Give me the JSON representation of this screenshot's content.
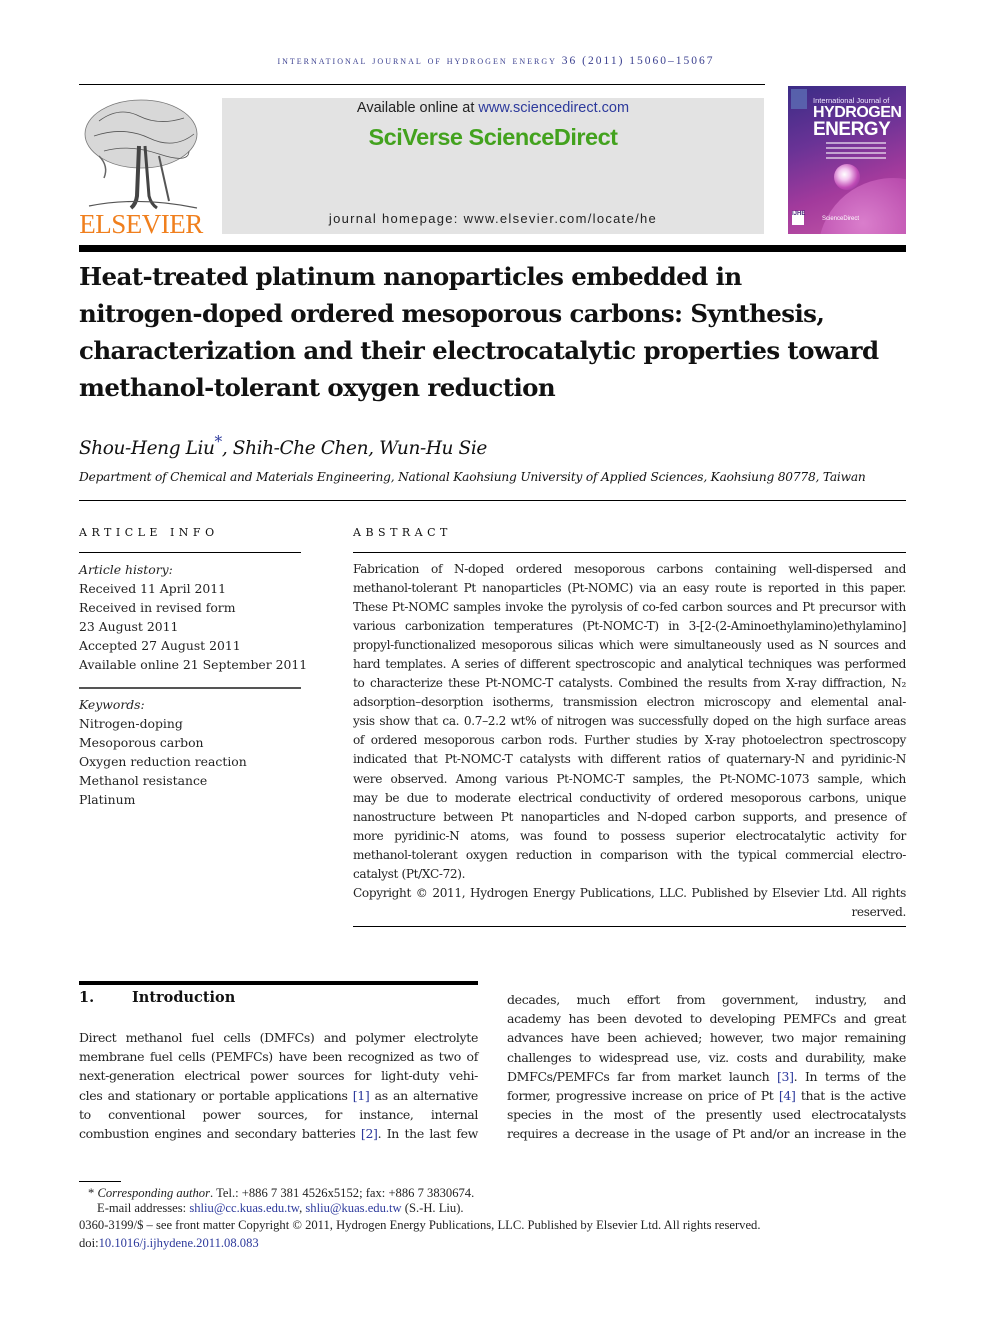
{
  "running_header": "INTERNATIONAL JOURNAL OF HYDROGEN ENERGY 36 (2011) 15060–15067",
  "masthead": {
    "publisher_logo": {
      "icon": "elsevier-tree-icon",
      "wordmark": "ELSEVIER"
    },
    "available_online_prefix": "Available online at ",
    "available_online_link": "www.sciencedirect.com",
    "platform_name": "SciVerse ScienceDirect",
    "journal_homepage": "journal homepage: www.elsevier.com/locate/he",
    "cover": {
      "line1": "International Journal of",
      "line2": "HYDROGEN",
      "line3": "ENERGY",
      "badge": "IJHE",
      "footer": "ScienceDirect"
    },
    "colors": {
      "elsevier_orange": "#f07f1d",
      "sciverse_green": "#43a21e",
      "link_blue": "#2d3a9c",
      "banner_grey": "#e3e3e3"
    }
  },
  "article": {
    "title_lines": [
      "Heat-treated platinum nanoparticles embedded in",
      "nitrogen-doped ordered mesoporous carbons: Synthesis,",
      "characterization and their electrocatalytic properties toward",
      "methanol-tolerant oxygen reduction"
    ],
    "authors": {
      "first": "Shou-Heng Liu",
      "marker": "*",
      "rest": ", Shih-Che Chen, Wun-Hu Sie"
    },
    "affiliation": "Department of Chemical and Materials Engineering, National Kaohsiung University of Applied Sciences, Kaohsiung 80778, Taiwan"
  },
  "article_info": {
    "heading": "ARTICLE INFO",
    "history_label": "Article history:",
    "history": [
      "Received 11 April 2011",
      "Received in revised form",
      "23 August 2011",
      "Accepted 27 August 2011",
      "Available online 21 September 2011"
    ],
    "keywords_label": "Keywords:",
    "keywords": [
      "Nitrogen-doping",
      "Mesoporous carbon",
      "Oxygen reduction reaction",
      "Methanol resistance",
      "Platinum"
    ]
  },
  "abstract": {
    "heading": "ABSTRACT",
    "lines": [
      "Fabrication of N-doped ordered mesoporous carbons containing well-dispersed and",
      "methanol-tolerant Pt nanoparticles (Pt-NOMC) via an easy route is reported in this paper.",
      "These Pt-NOMC samples invoke the pyrolysis of co-fed carbon sources and Pt precursor with",
      "various carbonization temperatures (Pt-NOMC-T) in 3-[2-(2-Aminoethylamino)ethylamino]",
      "propyl-functionalized mesoporous silicas which were simultaneously used as N sources and",
      "hard templates. A series of different spectroscopic and analytical techniques was performed",
      "to characterize these Pt-NOMC-T catalysts. Combined the results from X-ray diffraction, N₂",
      "adsorption–desorption isotherms, transmission electron microscopy and elemental anal-",
      "ysis show that ca. 0.7–2.2 wt% of nitrogen was successfully doped on the high surface areas",
      "of ordered mesoporous carbon rods. Further studies by X-ray photoelectron spectroscopy",
      "indicated that Pt-NOMC-T catalysts with different ratios of quaternary-N and pyridinic-N",
      "were observed. Among various Pt-NOMC-T samples, the Pt-NOMC-1073 sample, which",
      "may be due to moderate electrical conductivity of ordered mesoporous carbons, unique",
      "nanostructure between Pt nanoparticles and N-doped carbon supports, and presence of",
      "more pyridinic-N atoms, was found to possess superior electrocatalytic activity for",
      "methanol-tolerant oxygen reduction in comparison with the typical commercial electro-",
      "catalyst (Pt/XC-72)."
    ],
    "copyright_line1": "Copyright © 2011, Hydrogen Energy Publications, LLC. Published by Elsevier Ltd. All rights",
    "copyright_line2": "reserved."
  },
  "introduction": {
    "number": "1.",
    "heading": "Introduction",
    "left_lines": [
      {
        "pre": "Direct methanol fuel cells (DMFCs) and polymer electrolyte"
      },
      {
        "pre": "membrane fuel cells (PEMFCs) have been recognized as two of"
      },
      {
        "pre": "next-generation electrical power sources for light-duty vehi-"
      },
      {
        "pre": "cles and stationary or portable applications ",
        "ref": "[1]",
        "post": " as an alternative"
      },
      {
        "pre": "to conventional power sources, for instance, internal"
      },
      {
        "pre": "combustion engines and secondary batteries ",
        "ref": "[2]",
        "post": ". In the last few"
      }
    ],
    "right_lines": [
      {
        "pre": "decades, much effort from government, industry, and"
      },
      {
        "pre": "academy has been devoted to developing PEMFCs and great"
      },
      {
        "pre": "advances have been achieved; however, two major remaining"
      },
      {
        "pre": "challenges to widespread use, viz. costs and durability, make"
      },
      {
        "pre": "DMFCs/PEMFCs far from market launch ",
        "ref": "[3]",
        "post": ". In terms of the"
      },
      {
        "pre": "former, progressive increase on price of Pt ",
        "ref": "[4]",
        "post": " that is the active"
      },
      {
        "pre": "species in the most of the presently used electrocatalysts"
      },
      {
        "pre": "requires a decrease in the usage of Pt and/or an increase in the"
      }
    ]
  },
  "footnotes": {
    "marker": "*",
    "corr_label": "Corresponding author",
    "corr_rest": ". Tel.: +886 7 381 4526x5152; fax: +886 7 3830674.",
    "email_label": "E-mail addresses: ",
    "email1": "shliu@cc.kuas.edu.tw",
    "email_sep": ", ",
    "email2": "shliu@kuas.edu.tw",
    "email_suffix": " (S.-H. Liu).",
    "issn_line": "0360-3199/$ – see front matter Copyright © 2011, Hydrogen Energy Publications, LLC. Published by Elsevier Ltd. All rights reserved.",
    "doi_prefix": "doi:",
    "doi": "10.1016/j.ijhydene.2011.08.083"
  }
}
